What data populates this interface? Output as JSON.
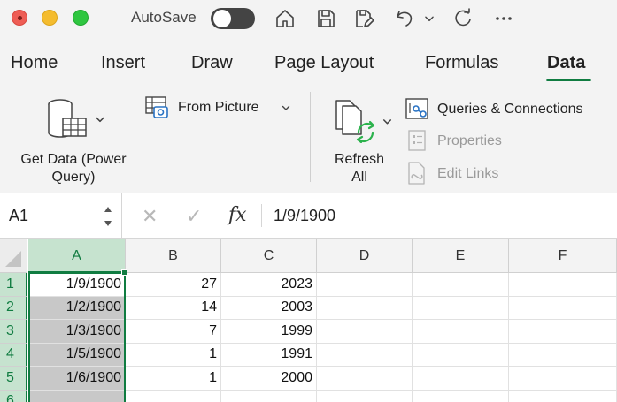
{
  "titlebar": {
    "autosave_label": "AutoSave",
    "autosave_on": false,
    "icons": [
      "home-icon",
      "save-icon",
      "save-as-icon",
      "undo-icon",
      "redo-icon",
      "more-icon"
    ]
  },
  "tabs": [
    {
      "label": "Home",
      "active": false
    },
    {
      "label": "Insert",
      "active": false
    },
    {
      "label": "Draw",
      "active": false
    },
    {
      "label": "Page Layout",
      "active": false
    },
    {
      "label": "Formulas",
      "active": false
    },
    {
      "label": "Data",
      "active": true
    }
  ],
  "ribbon": {
    "get_data_line1": "Get Data (Power",
    "get_data_line2": "Query)",
    "from_picture": "From Picture",
    "refresh_line1": "Refresh",
    "refresh_line2": "All",
    "queries_connections": "Queries & Connections",
    "properties": "Properties",
    "edit_links": "Edit Links"
  },
  "formula_bar": {
    "name_box": "A1",
    "fx_label": "fx",
    "content": "1/9/1900"
  },
  "grid": {
    "columns": [
      "A",
      "B",
      "C",
      "D",
      "E",
      "F"
    ],
    "selected_column": "A",
    "rows": [
      {
        "num": "1",
        "cells": [
          "1/9/1900",
          "27",
          "2023",
          "",
          "",
          ""
        ]
      },
      {
        "num": "2",
        "cells": [
          "1/2/1900",
          "14",
          "2003",
          "",
          "",
          ""
        ]
      },
      {
        "num": "3",
        "cells": [
          "1/3/1900",
          "7",
          "1999",
          "",
          "",
          ""
        ]
      },
      {
        "num": "4",
        "cells": [
          "1/5/1900",
          "1",
          "1991",
          "",
          "",
          ""
        ]
      },
      {
        "num": "5",
        "cells": [
          "1/6/1900",
          "1",
          "2000",
          "",
          "",
          ""
        ]
      },
      {
        "num": "6",
        "cells": [
          "",
          "",
          "",
          "",
          "",
          ""
        ]
      }
    ]
  },
  "colors": {
    "accent": "#107c41",
    "selection_fill": "#c8c8c8",
    "header_selected": "#c6e3cf"
  }
}
